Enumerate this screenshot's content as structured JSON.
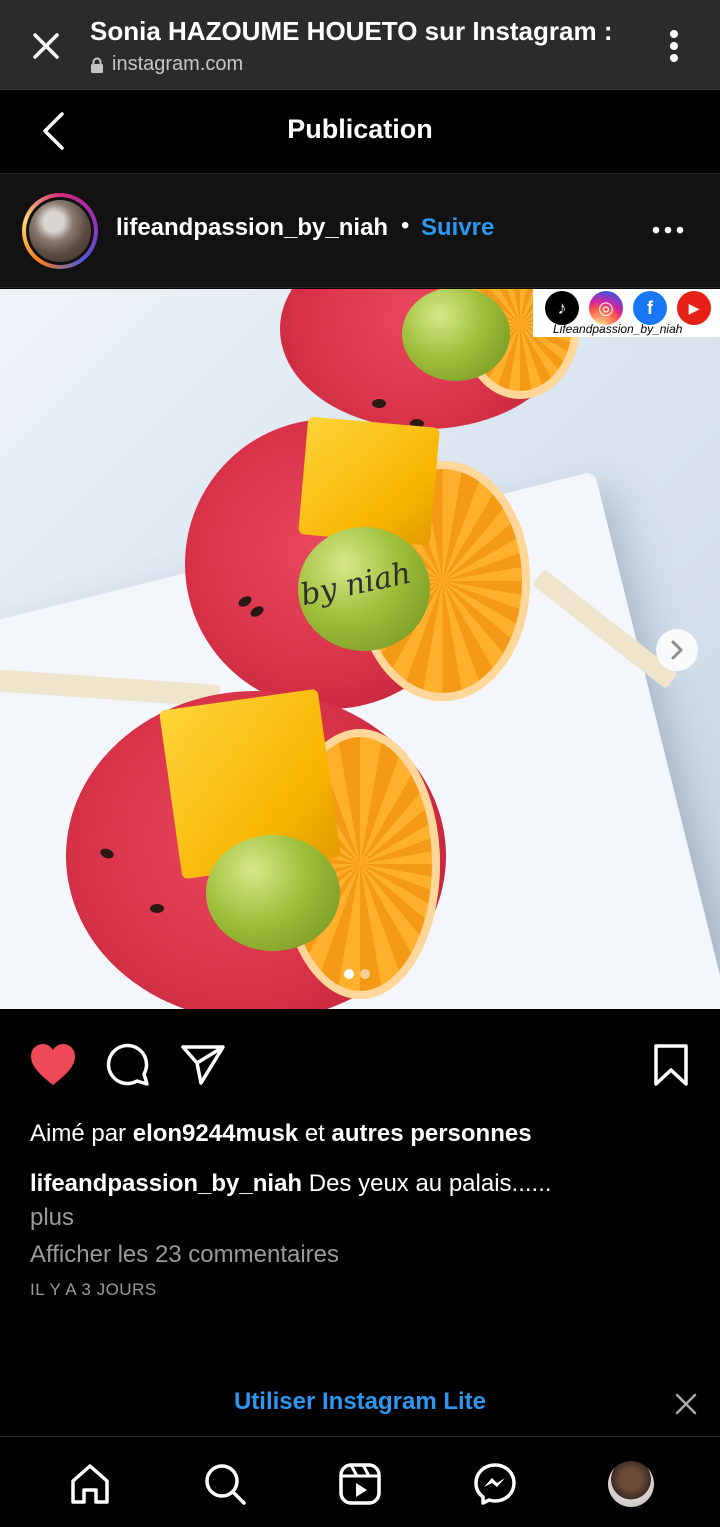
{
  "browser": {
    "title": "Sonia HAZOUME HOUETO sur Instagram :",
    "url": "instagram.com",
    "icons": {
      "close": "close-icon",
      "lock": "lock-icon",
      "menu": "more-vert-icon"
    }
  },
  "header": {
    "title": "Publication",
    "back_icon": "chevron-left-icon"
  },
  "post": {
    "username": "lifeandpassion_by_niah",
    "separator": "•",
    "follow_label": "Suivre",
    "more_icon": "more-horiz-icon",
    "image": {
      "watermark": "by niah",
      "social_handle": "Lifeandpassion_by_niah",
      "social_icons": [
        "tiktok-icon",
        "instagram-icon",
        "facebook-icon",
        "youtube-icon"
      ],
      "carousel": {
        "current": 1,
        "total": 2
      }
    },
    "actions": {
      "like_icon": "heart-icon",
      "liked": true,
      "comment_icon": "comment-icon",
      "share_icon": "send-icon",
      "save_icon": "bookmark-icon",
      "like_color": "#ed4956"
    },
    "likes": {
      "prefix": "Aimé par",
      "user": "elon9244musk",
      "connector": "et",
      "others": "autres personnes"
    },
    "caption": {
      "username": "lifeandpassion_by_niah",
      "text": "Des yeux au palais......",
      "more_label": "plus"
    },
    "comments_link": "Afficher les 23 commentaires",
    "timestamp": "IL Y A 3 JOURS"
  },
  "banner": {
    "label": "Utiliser Instagram Lite",
    "close_icon": "close-icon",
    "accent": "#2b97f0"
  },
  "bottom_nav": {
    "items": [
      "home-icon",
      "search-icon",
      "reels-icon",
      "messenger-icon",
      "profile-avatar"
    ]
  }
}
